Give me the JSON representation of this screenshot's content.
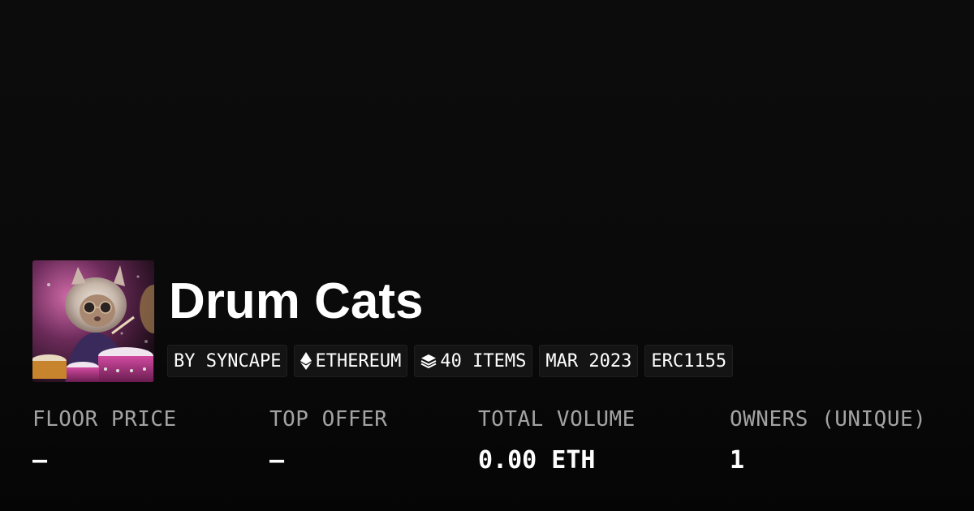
{
  "collection": {
    "title": "Drum Cats",
    "avatar_icon": "cat-drummer-image"
  },
  "chips": {
    "creator": "BY SYNCAPE",
    "chain": "ETHEREUM",
    "chain_icon": "ethereum-icon",
    "items": "40 ITEMS",
    "items_icon": "layers-icon",
    "date": "MAR 2023",
    "standard": "ERC1155"
  },
  "stats": {
    "floor_price": {
      "label": "FLOOR PRICE",
      "value": "–"
    },
    "top_offer": {
      "label": "TOP OFFER",
      "value": "–"
    },
    "total_volume": {
      "label": "TOTAL VOLUME",
      "value": "0.00 ETH"
    },
    "owners": {
      "label": "OWNERS (UNIQUE)",
      "value": "1"
    }
  },
  "colors": {
    "background": "#0b0b0b",
    "chip_background": "#141414",
    "label_gray": "#a3a3a3",
    "text": "#ffffff"
  }
}
